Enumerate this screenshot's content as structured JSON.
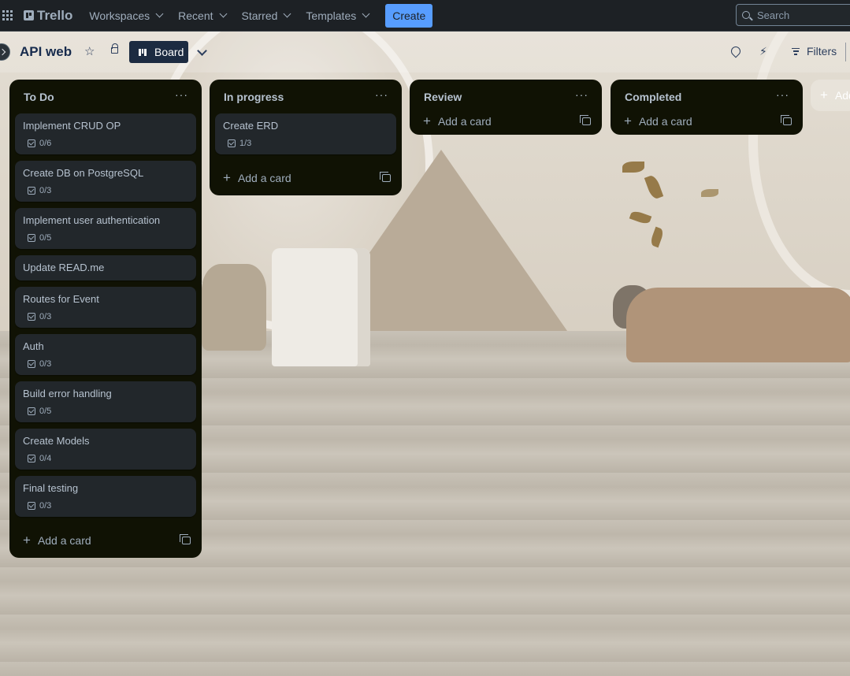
{
  "topnav": {
    "logo": "Trello",
    "menus": [
      {
        "label": "Workspaces"
      },
      {
        "label": "Recent"
      },
      {
        "label": "Starred"
      },
      {
        "label": "Templates"
      }
    ],
    "create_label": "Create",
    "search_placeholder": "Search"
  },
  "board": {
    "title": "API web",
    "view_label": "Board",
    "filters_label": "Filters"
  },
  "lists": [
    {
      "title": "To Do",
      "cards": [
        {
          "title": "Implement CRUD OP",
          "checklist": "0/6"
        },
        {
          "title": "Create DB on PostgreSQL",
          "checklist": "0/3"
        },
        {
          "title": "Implement user authentication",
          "checklist": "0/5"
        },
        {
          "title": "Update READ.me",
          "checklist": null
        },
        {
          "title": "Routes for Event",
          "checklist": "0/3"
        },
        {
          "title": "Auth",
          "checklist": "0/3"
        },
        {
          "title": "Build error handling",
          "checklist": "0/5"
        },
        {
          "title": "Create Models",
          "checklist": "0/4"
        },
        {
          "title": "Final testing",
          "checklist": "0/3"
        }
      ],
      "add_label": "Add a card"
    },
    {
      "title": "In progress",
      "cards": [
        {
          "title": "Create ERD",
          "checklist": "1/3"
        }
      ],
      "add_label": "Add a card"
    },
    {
      "title": "Review",
      "cards": [],
      "add_label": "Add a card"
    },
    {
      "title": "Completed",
      "cards": [],
      "add_label": "Add a card"
    }
  ],
  "add_list_label": "Add another list",
  "colors": {
    "nav_bg": "#1d2125",
    "list_bg": "#101204",
    "card_bg": "#22272b",
    "create_button": "#579dff",
    "view_button": "#1c2b41"
  }
}
